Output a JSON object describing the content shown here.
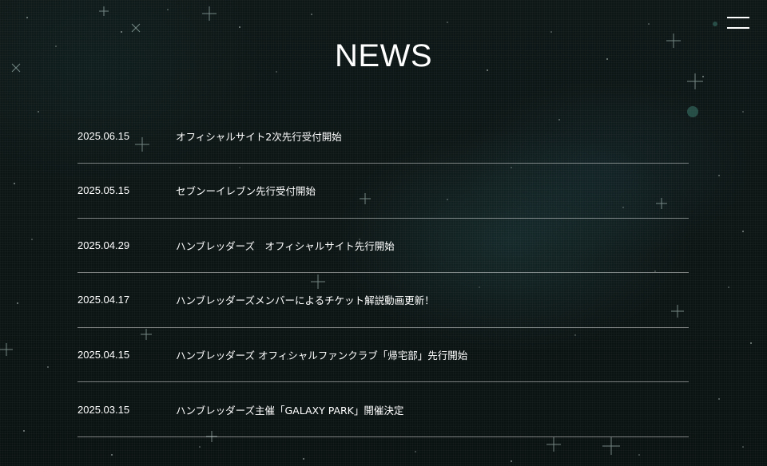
{
  "header": {
    "menu_icon": "hamburger-menu-icon"
  },
  "page": {
    "title": "NEWS"
  },
  "news": [
    {
      "date": "2025.06.15",
      "title": "オフィシャルサイト2次先行受付開始"
    },
    {
      "date": "2025.05.15",
      "title": "セブンーイレブン先行受付開始"
    },
    {
      "date": "2025.04.29",
      "title": "ハンブレッダーズ　オフィシャルサイト先行開始"
    },
    {
      "date": "2025.04.17",
      "title": "ハンブレッダーズメンバーによるチケット解説動画更新！"
    },
    {
      "date": "2025.04.15",
      "title": "ハンブレッダーズ オフィシャルファンクラブ「帰宅部」先行開始"
    },
    {
      "date": "2025.03.15",
      "title": "ハンブレッダーズ主催「GALAXY PARK」開催決定"
    }
  ],
  "colors": {
    "background": "#0b1413",
    "text": "#ffffff",
    "divider": "#8a8f8e"
  }
}
